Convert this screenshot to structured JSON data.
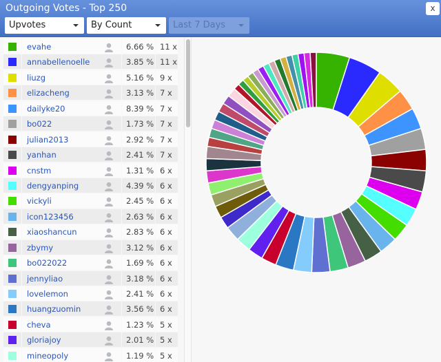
{
  "window": {
    "title": "Outgoing Votes - Top 250",
    "close_label": "x"
  },
  "filters": {
    "type": "Upvotes",
    "sort": "By Count",
    "period": "Last 7 Days",
    "period_disabled": true
  },
  "rows": [
    {
      "name": "evahe",
      "percent": "6.66 %",
      "count": "11 x",
      "color": "#36b300"
    },
    {
      "name": "annabellenoelle",
      "percent": "3.85 %",
      "count": "11 x",
      "color": "#2a2aff"
    },
    {
      "name": "liuzg",
      "percent": "5.16 %",
      "count": "9 x",
      "color": "#dede00"
    },
    {
      "name": "elizacheng",
      "percent": "3.13 %",
      "count": "7 x",
      "color": "#ff9146"
    },
    {
      "name": "dailyke20",
      "percent": "8.39 %",
      "count": "7 x",
      "color": "#3d94ff"
    },
    {
      "name": "bo022",
      "percent": "1.73 %",
      "count": "7 x",
      "color": "#a0a0a0"
    },
    {
      "name": "julian2013",
      "percent": "2.92 %",
      "count": "7 x",
      "color": "#8b0000"
    },
    {
      "name": "yanhan",
      "percent": "2.41 %",
      "count": "7 x",
      "color": "#4a4a4a"
    },
    {
      "name": "cnstm",
      "percent": "1.31 %",
      "count": "6 x",
      "color": "#dd00ee"
    },
    {
      "name": "dengyanping",
      "percent": "4.39 %",
      "count": "6 x",
      "color": "#55ffff"
    },
    {
      "name": "vickyli",
      "percent": "2.45 %",
      "count": "6 x",
      "color": "#44dd00"
    },
    {
      "name": "icon123456",
      "percent": "2.63 %",
      "count": "6 x",
      "color": "#6ab4ee"
    },
    {
      "name": "xiaoshancun",
      "percent": "2.83 %",
      "count": "6 x",
      "color": "#466046"
    },
    {
      "name": "zbymy",
      "percent": "3.12 %",
      "count": "6 x",
      "color": "#98649e"
    },
    {
      "name": "bo022022",
      "percent": "1.69 %",
      "count": "6 x",
      "color": "#3ec67a"
    },
    {
      "name": "jennyliao",
      "percent": "3.18 %",
      "count": "6 x",
      "color": "#6070d0"
    },
    {
      "name": "lovelemon",
      "percent": "2.41 %",
      "count": "6 x",
      "color": "#84ccfc"
    },
    {
      "name": "huangzuomin",
      "percent": "3.56 %",
      "count": "6 x",
      "color": "#2a78c4"
    },
    {
      "name": "cheva",
      "percent": "1.23 %",
      "count": "5 x",
      "color": "#c8002e"
    },
    {
      "name": "gloriajoy",
      "percent": "2.01 %",
      "count": "5 x",
      "color": "#6020ee"
    },
    {
      "name": "mineopoly",
      "percent": "1.19 %",
      "count": "5 x",
      "color": "#9effde"
    }
  ],
  "chart_data": {
    "type": "pie",
    "donut": true,
    "values": [
      11,
      11,
      9,
      7,
      7,
      7,
      7,
      7,
      6,
      6,
      6,
      6,
      6,
      6,
      6,
      6,
      6,
      6,
      5,
      5,
      5,
      5,
      4,
      4,
      4,
      4,
      4,
      4,
      4,
      3,
      3,
      3,
      3,
      3,
      3,
      3,
      2,
      2,
      2,
      2,
      2,
      2,
      2,
      2,
      2,
      2,
      2,
      2,
      2,
      2,
      2
    ],
    "colors": [
      "#36b300",
      "#2a2aff",
      "#dede00",
      "#ff9146",
      "#3d94ff",
      "#a0a0a0",
      "#8b0000",
      "#4a4a4a",
      "#dd00ee",
      "#55ffff",
      "#44dd00",
      "#6ab4ee",
      "#466046",
      "#98649e",
      "#3ec67a",
      "#6070d0",
      "#84ccfc",
      "#2a78c4",
      "#c8002e",
      "#6020ee",
      "#9effde",
      "#90b0dc",
      "#3e2ac8",
      "#6e5c0a",
      "#9aa060",
      "#8fef6e",
      "#dd36cc",
      "#1b333f",
      "#a2868f",
      "#b84040",
      "#4fa585",
      "#cc80d6",
      "#1f5d8a",
      "#c04a6a",
      "#9050c0",
      "#fbd6e0",
      "#b0162a",
      "#2e9e3e",
      "#b5cc2a",
      "#8aad5a",
      "#c89ad0",
      "#9a1ff0",
      "#4de8c0",
      "#d0aaaa",
      "#237a2e",
      "#d4b040",
      "#4490a8",
      "#40d0a8",
      "#a010f0",
      "#d828e0",
      "#8a1040"
    ]
  }
}
